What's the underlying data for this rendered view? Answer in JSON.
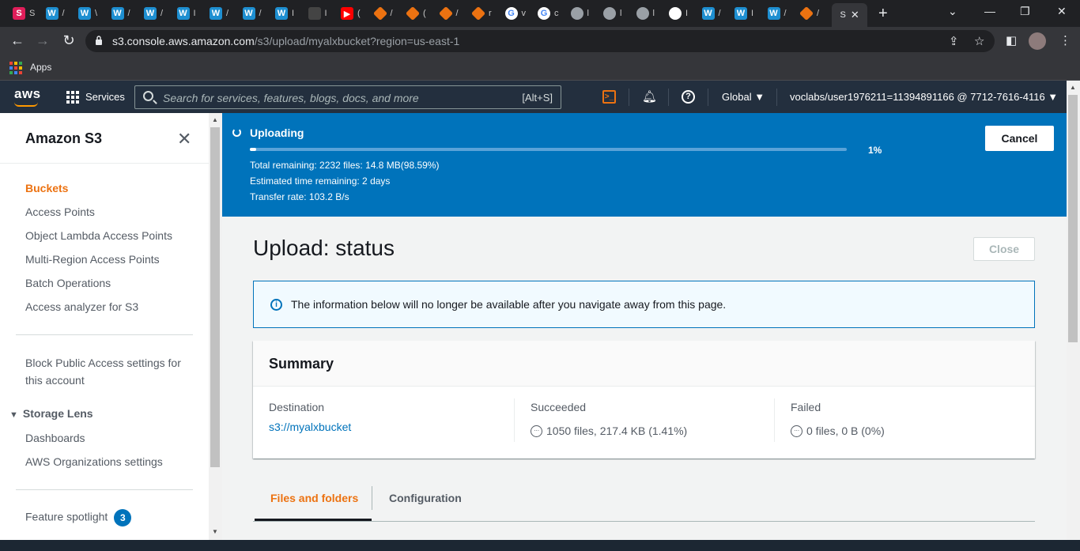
{
  "browser": {
    "tabs": [
      {
        "icon": "slack-icon",
        "color": "#e01e5a",
        "char": "S",
        "label": "S"
      },
      {
        "icon": "w-app-icon",
        "color": "#1e8fd1",
        "char": "W",
        "label": "/"
      },
      {
        "icon": "w-app-icon",
        "color": "#1e8fd1",
        "char": "W",
        "label": "\\"
      },
      {
        "icon": "w-app-icon",
        "color": "#1e8fd1",
        "char": "W",
        "label": "/"
      },
      {
        "icon": "w-app-icon",
        "color": "#1e8fd1",
        "char": "W",
        "label": "/"
      },
      {
        "icon": "w-app-icon",
        "color": "#1e8fd1",
        "char": "W",
        "label": "I"
      },
      {
        "icon": "w-app-icon",
        "color": "#1e8fd1",
        "char": "W",
        "label": "/"
      },
      {
        "icon": "w-app-icon",
        "color": "#1e8fd1",
        "char": "W",
        "label": "/"
      },
      {
        "icon": "w-app-icon",
        "color": "#1e8fd1",
        "char": "W",
        "label": "I"
      },
      {
        "icon": "page-icon",
        "color": "#444444",
        "char": "",
        "label": "I"
      },
      {
        "icon": "youtube-icon",
        "color": "#ff0000",
        "char": "▶",
        "label": "("
      },
      {
        "icon": "aws-cube-icon",
        "color": "#ec7211",
        "char": "",
        "label": "/"
      },
      {
        "icon": "aws-cube-icon",
        "color": "#ec7211",
        "char": "",
        "label": "("
      },
      {
        "icon": "aws-cube-icon",
        "color": "#ec7211",
        "char": "",
        "label": "/"
      },
      {
        "icon": "aws-cube-icon",
        "color": "#ec7211",
        "char": "",
        "label": "r"
      },
      {
        "icon": "google-icon",
        "color": "#ffffff",
        "char": "G",
        "label": "v"
      },
      {
        "icon": "google-icon",
        "color": "#ffffff",
        "char": "G",
        "label": "c"
      },
      {
        "icon": "globe-icon",
        "color": "#9aa0a6",
        "char": "",
        "label": "l"
      },
      {
        "icon": "globe-icon",
        "color": "#9aa0a6",
        "char": "",
        "label": "l"
      },
      {
        "icon": "globe-icon",
        "color": "#9aa0a6",
        "char": "",
        "label": "l"
      },
      {
        "icon": "github-icon",
        "color": "#ffffff",
        "char": "",
        "label": "I"
      },
      {
        "icon": "w-app-icon",
        "color": "#1e8fd1",
        "char": "W",
        "label": "/"
      },
      {
        "icon": "w-app-icon",
        "color": "#1e8fd1",
        "char": "W",
        "label": "I"
      },
      {
        "icon": "w-app-icon",
        "color": "#1e8fd1",
        "char": "W",
        "label": "/"
      },
      {
        "icon": "aws-cube-icon",
        "color": "#ec7211",
        "char": "",
        "label": "/"
      }
    ],
    "active_tab": {
      "label": "S"
    },
    "url_host": "s3.console.aws.amazon.com",
    "url_path": "/s3/upload/myalxbucket?region=us-east-1",
    "bookmarks_apps": "Apps"
  },
  "aws_nav": {
    "logo": "aws",
    "services": "Services",
    "search_placeholder": "Search for services, features, blogs, docs, and more",
    "search_shortcut": "[Alt+S]",
    "cloudshell_char": ">_",
    "help_char": "?",
    "region": "Global ▼",
    "account": "voclabs/user1976211=11394891166 @ 7712-7616-4116 ▼"
  },
  "sidebar": {
    "title": "Amazon S3",
    "items": [
      "Buckets",
      "Access Points",
      "Object Lambda Access Points",
      "Multi-Region Access Points",
      "Batch Operations",
      "Access analyzer for S3"
    ],
    "block_public_line1": "Block Public Access settings for",
    "block_public_line2": "this account",
    "storage_lens": "Storage Lens",
    "storage_lens_items": [
      "Dashboards",
      "AWS Organizations settings"
    ],
    "feature_spotlight": "Feature spotlight",
    "feature_badge": "3"
  },
  "upload_banner": {
    "title": "Uploading",
    "progress_fraction": 0.01,
    "percent_label": "1%",
    "total_remaining": "Total remaining: 2232 files: 14.8 MB(98.59%)",
    "time_remaining": "Estimated time remaining: 2 days",
    "transfer_rate": "Transfer rate: 103.2 B/s",
    "cancel_label": "Cancel",
    "bg_color": "#0073bb"
  },
  "main": {
    "title": "Upload: status",
    "close_label": "Close",
    "info_text": "The information below will no longer be available after you navigate away from this page.",
    "summary": {
      "title": "Summary",
      "destination_label": "Destination",
      "destination_value": "s3://myalxbucket",
      "succeeded_label": "Succeeded",
      "succeeded_value": "1050 files, 217.4 KB (1.41%)",
      "failed_label": "Failed",
      "failed_value": "0 files, 0 B (0%)"
    },
    "tabs": [
      "Files and folders",
      "Configuration"
    ],
    "accent": "#ec7211"
  }
}
